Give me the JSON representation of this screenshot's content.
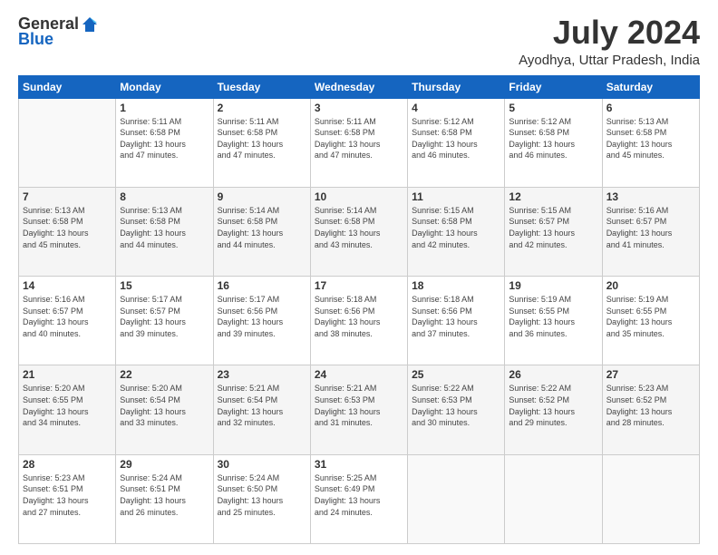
{
  "logo": {
    "general": "General",
    "blue": "Blue"
  },
  "title": "July 2024",
  "location": "Ayodhya, Uttar Pradesh, India",
  "days_of_week": [
    "Sunday",
    "Monday",
    "Tuesday",
    "Wednesday",
    "Thursday",
    "Friday",
    "Saturday"
  ],
  "weeks": [
    [
      {
        "day": "",
        "info": ""
      },
      {
        "day": "1",
        "info": "Sunrise: 5:11 AM\nSunset: 6:58 PM\nDaylight: 13 hours\nand 47 minutes."
      },
      {
        "day": "2",
        "info": "Sunrise: 5:11 AM\nSunset: 6:58 PM\nDaylight: 13 hours\nand 47 minutes."
      },
      {
        "day": "3",
        "info": "Sunrise: 5:11 AM\nSunset: 6:58 PM\nDaylight: 13 hours\nand 47 minutes."
      },
      {
        "day": "4",
        "info": "Sunrise: 5:12 AM\nSunset: 6:58 PM\nDaylight: 13 hours\nand 46 minutes."
      },
      {
        "day": "5",
        "info": "Sunrise: 5:12 AM\nSunset: 6:58 PM\nDaylight: 13 hours\nand 46 minutes."
      },
      {
        "day": "6",
        "info": "Sunrise: 5:13 AM\nSunset: 6:58 PM\nDaylight: 13 hours\nand 45 minutes."
      }
    ],
    [
      {
        "day": "7",
        "info": "Sunrise: 5:13 AM\nSunset: 6:58 PM\nDaylight: 13 hours\nand 45 minutes."
      },
      {
        "day": "8",
        "info": "Sunrise: 5:13 AM\nSunset: 6:58 PM\nDaylight: 13 hours\nand 44 minutes."
      },
      {
        "day": "9",
        "info": "Sunrise: 5:14 AM\nSunset: 6:58 PM\nDaylight: 13 hours\nand 44 minutes."
      },
      {
        "day": "10",
        "info": "Sunrise: 5:14 AM\nSunset: 6:58 PM\nDaylight: 13 hours\nand 43 minutes."
      },
      {
        "day": "11",
        "info": "Sunrise: 5:15 AM\nSunset: 6:58 PM\nDaylight: 13 hours\nand 42 minutes."
      },
      {
        "day": "12",
        "info": "Sunrise: 5:15 AM\nSunset: 6:57 PM\nDaylight: 13 hours\nand 42 minutes."
      },
      {
        "day": "13",
        "info": "Sunrise: 5:16 AM\nSunset: 6:57 PM\nDaylight: 13 hours\nand 41 minutes."
      }
    ],
    [
      {
        "day": "14",
        "info": "Sunrise: 5:16 AM\nSunset: 6:57 PM\nDaylight: 13 hours\nand 40 minutes."
      },
      {
        "day": "15",
        "info": "Sunrise: 5:17 AM\nSunset: 6:57 PM\nDaylight: 13 hours\nand 39 minutes."
      },
      {
        "day": "16",
        "info": "Sunrise: 5:17 AM\nSunset: 6:56 PM\nDaylight: 13 hours\nand 39 minutes."
      },
      {
        "day": "17",
        "info": "Sunrise: 5:18 AM\nSunset: 6:56 PM\nDaylight: 13 hours\nand 38 minutes."
      },
      {
        "day": "18",
        "info": "Sunrise: 5:18 AM\nSunset: 6:56 PM\nDaylight: 13 hours\nand 37 minutes."
      },
      {
        "day": "19",
        "info": "Sunrise: 5:19 AM\nSunset: 6:55 PM\nDaylight: 13 hours\nand 36 minutes."
      },
      {
        "day": "20",
        "info": "Sunrise: 5:19 AM\nSunset: 6:55 PM\nDaylight: 13 hours\nand 35 minutes."
      }
    ],
    [
      {
        "day": "21",
        "info": "Sunrise: 5:20 AM\nSunset: 6:55 PM\nDaylight: 13 hours\nand 34 minutes."
      },
      {
        "day": "22",
        "info": "Sunrise: 5:20 AM\nSunset: 6:54 PM\nDaylight: 13 hours\nand 33 minutes."
      },
      {
        "day": "23",
        "info": "Sunrise: 5:21 AM\nSunset: 6:54 PM\nDaylight: 13 hours\nand 32 minutes."
      },
      {
        "day": "24",
        "info": "Sunrise: 5:21 AM\nSunset: 6:53 PM\nDaylight: 13 hours\nand 31 minutes."
      },
      {
        "day": "25",
        "info": "Sunrise: 5:22 AM\nSunset: 6:53 PM\nDaylight: 13 hours\nand 30 minutes."
      },
      {
        "day": "26",
        "info": "Sunrise: 5:22 AM\nSunset: 6:52 PM\nDaylight: 13 hours\nand 29 minutes."
      },
      {
        "day": "27",
        "info": "Sunrise: 5:23 AM\nSunset: 6:52 PM\nDaylight: 13 hours\nand 28 minutes."
      }
    ],
    [
      {
        "day": "28",
        "info": "Sunrise: 5:23 AM\nSunset: 6:51 PM\nDaylight: 13 hours\nand 27 minutes."
      },
      {
        "day": "29",
        "info": "Sunrise: 5:24 AM\nSunset: 6:51 PM\nDaylight: 13 hours\nand 26 minutes."
      },
      {
        "day": "30",
        "info": "Sunrise: 5:24 AM\nSunset: 6:50 PM\nDaylight: 13 hours\nand 25 minutes."
      },
      {
        "day": "31",
        "info": "Sunrise: 5:25 AM\nSunset: 6:49 PM\nDaylight: 13 hours\nand 24 minutes."
      },
      {
        "day": "",
        "info": ""
      },
      {
        "day": "",
        "info": ""
      },
      {
        "day": "",
        "info": ""
      }
    ]
  ]
}
